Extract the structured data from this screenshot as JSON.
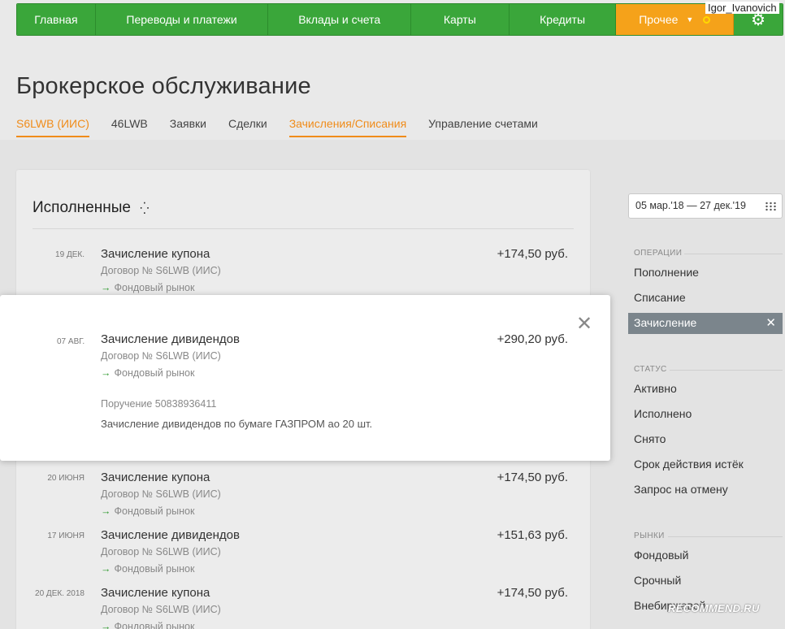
{
  "nav": {
    "items": [
      "Главная",
      "Переводы и платежи",
      "Вклады и счета",
      "Карты",
      "Кредиты"
    ],
    "other_label": "Прочее",
    "username": "Igor_Ivanovich"
  },
  "page_title": "Брокерское обслуживание",
  "tabs": [
    "S6LWB (ИИС)",
    "46LWB",
    "Заявки",
    "Сделки",
    "Зачисления/Списания",
    "Управление счетами"
  ],
  "card": {
    "title": "Исполненные"
  },
  "operations": [
    {
      "date": "19 ДЕК.",
      "name": "Зачисление купона",
      "contract": "Договор № S6LWB (ИИС)",
      "market": "Фондовый рынок",
      "amount": "+174,50 руб."
    },
    {
      "date": "20 ИЮНЯ",
      "name": "Зачисление купона",
      "contract": "Договор № S6LWB (ИИС)",
      "market": "Фондовый рынок",
      "amount": "+174,50 руб."
    },
    {
      "date": "17 ИЮНЯ",
      "name": "Зачисление дивидендов",
      "contract": "Договор № S6LWB (ИИС)",
      "market": "Фондовый рынок",
      "amount": "+151,63 руб."
    },
    {
      "date": "20 ДЕК. 2018",
      "name": "Зачисление купона",
      "contract": "Договор № S6LWB (ИИС)",
      "market": "Фондовый рынок",
      "amount": "+174,50 руб."
    }
  ],
  "popup": {
    "date": "07 АВГ.",
    "name": "Зачисление дивидендов",
    "contract": "Договор № S6LWB (ИИС)",
    "market": "Фондовый рынок",
    "amount": "+290,20 руб.",
    "order": "Поручение 50838936411",
    "details": "Зачисление дивидендов по бумаге ГАЗПРОМ ао 20 шт."
  },
  "filters": {
    "date_range": "05 мар.'18 — 27 дек.'19",
    "operations_head": "ОПЕРАЦИИ",
    "operations": [
      "Пополнение",
      "Списание",
      "Зачисление"
    ],
    "status_head": "СТАТУС",
    "status": [
      "Активно",
      "Исполнено",
      "Снято",
      "Срок действия истёк",
      "Запрос на отмену"
    ],
    "markets_head": "РЫНКИ",
    "markets": [
      "Фондовый",
      "Срочный",
      "Внебиржевой"
    ]
  },
  "watermark": "RECOMMEND.RU",
  "icons": {
    "close": "close-icon",
    "gear": "gear-icon",
    "calendar": "calendar-icon",
    "arrow": "arrow-right-icon"
  },
  "colors": {
    "nav_green": "#3aa63a",
    "nav_orange": "#f5a21a",
    "tab_active": "#f08c1a",
    "filter_active": "#7b858c"
  }
}
